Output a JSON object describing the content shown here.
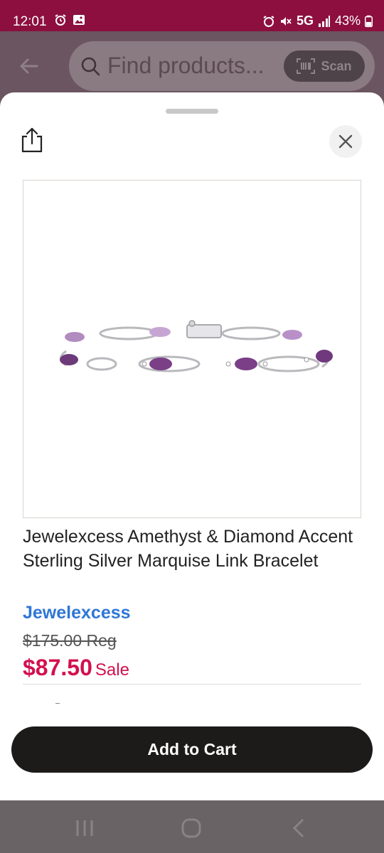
{
  "status_bar": {
    "time": "12:01",
    "network": "5G",
    "battery": "43%"
  },
  "header": {
    "search_placeholder": "Find products...",
    "scan_label": "Scan"
  },
  "product": {
    "title": "Jewelexcess Amethyst & Diamond Accent Sterling Silver Marquise Link Bracelet",
    "brand": "Jewelexcess",
    "regular_price": "$175.00 Reg",
    "sale_price": "$87.50",
    "sale_label": "Sale"
  },
  "actions": {
    "add_to_cart": "Add to Cart"
  },
  "colors": {
    "status_bar": "#8c0f3f",
    "sale": "#d3104f",
    "brand_link": "#2f76d6",
    "cart_button": "#1d1a1a"
  },
  "icons": [
    "alarm-icon",
    "gallery-icon",
    "mute-icon",
    "signal-icon",
    "battery-icon",
    "back-arrow-icon",
    "search-icon",
    "barcode-icon",
    "share-icon",
    "close-icon",
    "recents-icon",
    "home-icon",
    "back-icon"
  ]
}
